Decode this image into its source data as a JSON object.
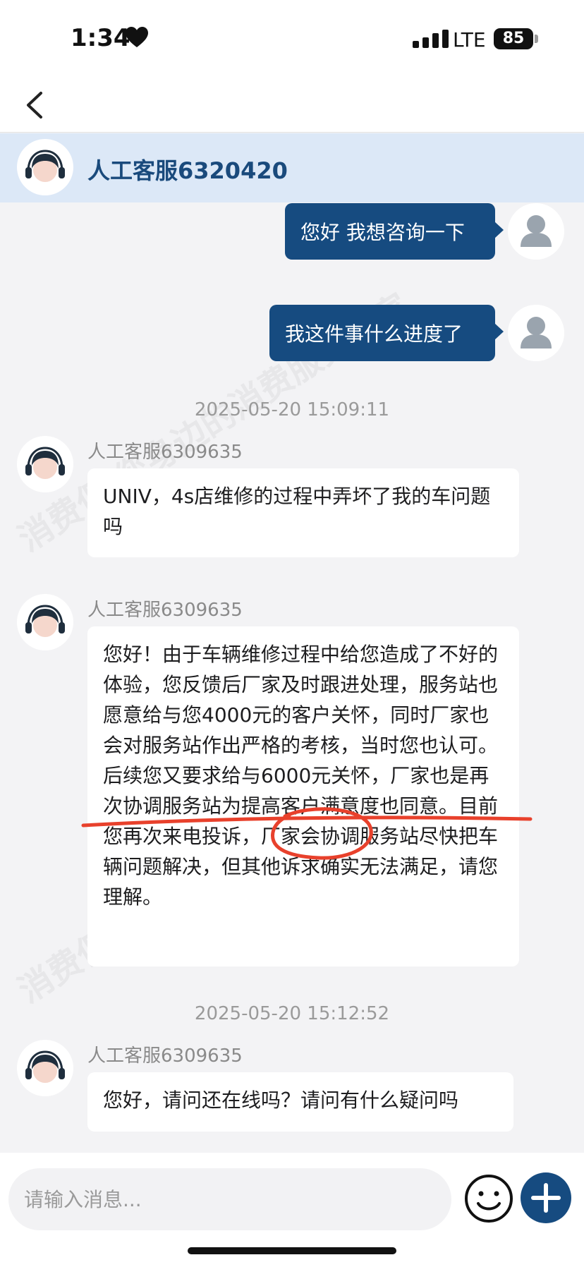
{
  "status_bar": {
    "time": "1:34",
    "network": "LTE",
    "battery": "85"
  },
  "header": {
    "agent_name": "人工客服6320420"
  },
  "messages": [
    {
      "type": "out",
      "text": "您好 我想咨询一下"
    },
    {
      "type": "out",
      "text": "我这件事什么进度了"
    },
    {
      "type": "time",
      "text": "2025-05-20 15:09:11"
    },
    {
      "type": "in",
      "sender": "人工客服6309635",
      "text": "UNIV，4s店维修的过程中弄坏了我的车问题吗"
    },
    {
      "type": "in",
      "sender": "人工客服6309635",
      "text": "您好！由于车辆维修过程中给您造成了不好的体验，您反馈后厂家及时跟进处理，服务站也愿意给与您4000元的客户关怀，同时厂家也会对服务站作出严格的考核，当时您也认可。后续您又要求给与6000元关怀，厂家也是再次协调服务站为提高客户满意度也同意。目前您再次来电投诉，厂家会协调服务站尽快把车辆问题解决，但其他诉求确实无法满足，请您理解。"
    },
    {
      "type": "time",
      "text": "2025-05-20 15:12:52"
    },
    {
      "type": "in",
      "sender": "人工客服6309635",
      "text": "您好，请问还在线吗？请问有什么疑问吗"
    }
  ],
  "input": {
    "placeholder": "请输入消息..."
  },
  "watermark": {
    "text": "消费保 您身边的消费服务管家"
  },
  "colors": {
    "brand": "#164b80",
    "header_bg": "#dce8f7",
    "annotation": "#e8412c"
  }
}
